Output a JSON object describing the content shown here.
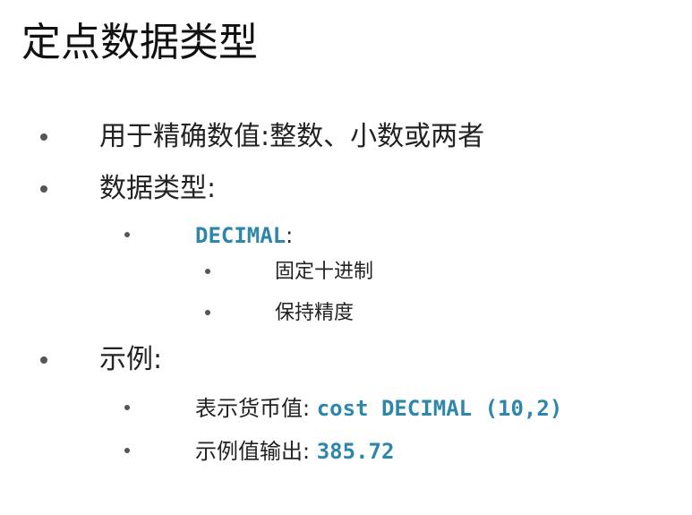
{
  "title": "定点数据类型",
  "bullets": {
    "b1": "用于精确数值:整数、小数或两者",
    "b2": "数据类型:",
    "b2_1_code": "DECIMAL",
    "b2_1_suffix": ":",
    "b2_1_1": "固定十进制",
    "b2_1_2": "保持精度",
    "b3": "示例:",
    "b3_1_label": "表示货币值:",
    "b3_1_code": "cost DECIMAL (10,2)",
    "b3_2_label": "示例值输出:",
    "b3_2_code": "385.72"
  },
  "colors": {
    "code": "#2e86ab",
    "text": "#222222",
    "bullet": "#555555"
  }
}
